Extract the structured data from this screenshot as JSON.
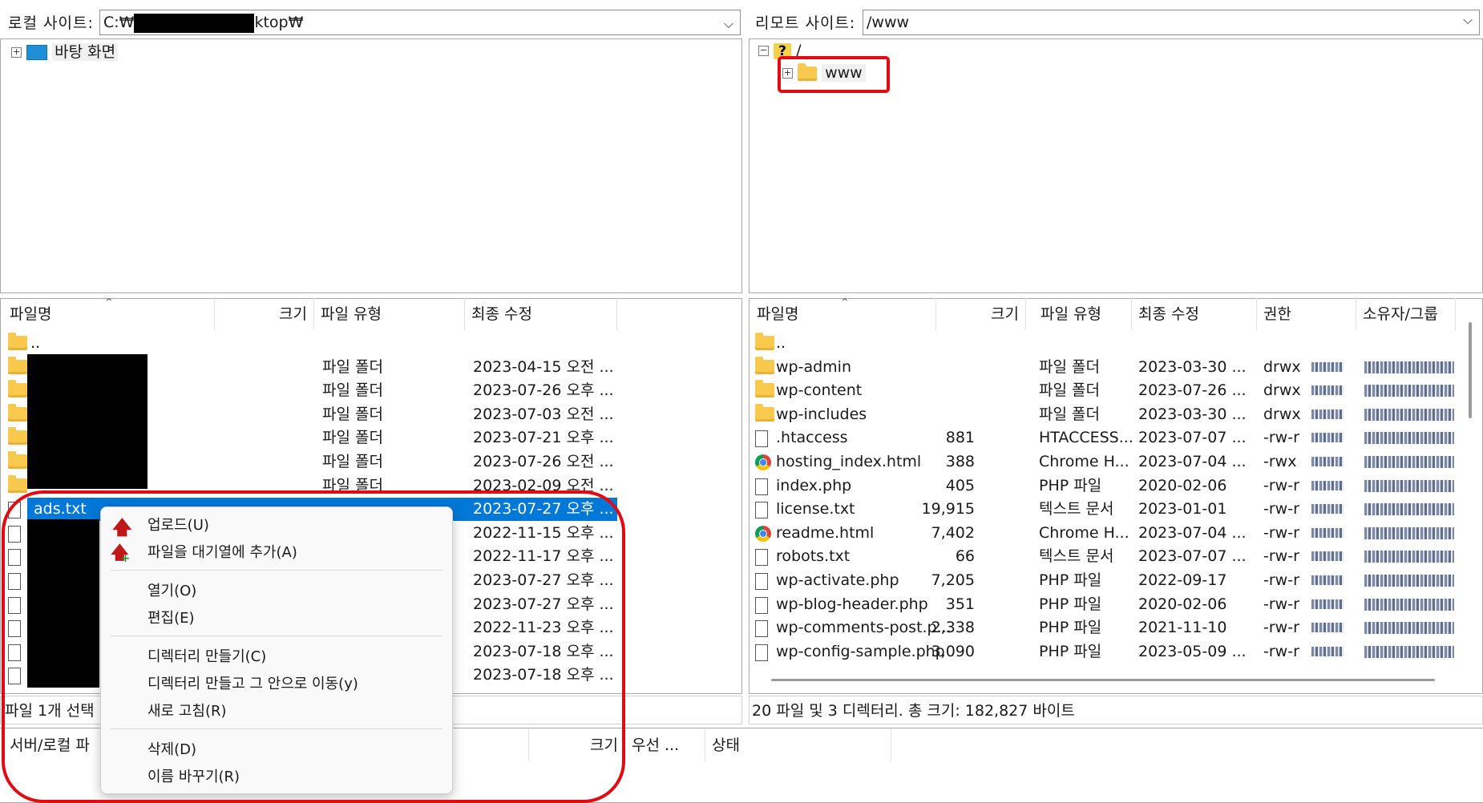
{
  "local": {
    "site_label": "로컬 사이트:",
    "path_prefix": "C:₩",
    "path_suffix": "ktop₩",
    "tree_item": "바탕 화면",
    "columns": [
      "파일명",
      "크기",
      "파일 유형",
      "최종 수정"
    ],
    "rows": [
      {
        "name": "..",
        "type": "",
        "date": ""
      },
      {
        "name": "",
        "type": "파일 폴더",
        "date": "2023-04-15 오전 ..."
      },
      {
        "name": "",
        "type": "파일 폴더",
        "date": "2023-07-26 오후 ..."
      },
      {
        "name": "",
        "type": "파일 폴더",
        "date": "2023-07-03 오전 ..."
      },
      {
        "name": "",
        "type": "파일 폴더",
        "date": "2023-07-21 오후 ..."
      },
      {
        "name": "",
        "type": "파일 폴더",
        "date": "2023-07-26 오전 ..."
      },
      {
        "name": "",
        "type": "파일 폴더",
        "date": "2023-02-09 오전 ..."
      },
      {
        "name": "ads.txt",
        "type": "",
        "date": "2023-07-27 오후 ..."
      },
      {
        "name": "",
        "type": "",
        "date": "2022-11-15 오후 ..."
      },
      {
        "name": "",
        "type": "",
        "date": "2022-11-17 오후 ..."
      },
      {
        "name": "",
        "type": "",
        "date": "2023-07-27 오후 ..."
      },
      {
        "name": "",
        "type": "",
        "date": "2023-07-27 오후 ..."
      },
      {
        "name": "",
        "type": "",
        "date": "2022-11-23 오후 ..."
      },
      {
        "name": "",
        "type": "",
        "date": "2023-07-18 오후 ..."
      },
      {
        "name": "",
        "type": "",
        "date": "2023-07-18 오후 ..."
      }
    ],
    "status": "파일 1개 선택"
  },
  "remote": {
    "site_label": "리모트 사이트:",
    "path": "/www",
    "tree_root": "/",
    "tree_item": "www",
    "columns": [
      "파일명",
      "크기",
      "파일 유형",
      "최종 수정",
      "권한",
      "소유자/그룹"
    ],
    "rows": [
      {
        "name": "..",
        "size": "",
        "type": "",
        "date": "",
        "perm": "",
        "icon": "folder"
      },
      {
        "name": "wp-admin",
        "size": "",
        "type": "파일 폴더",
        "date": "2023-03-30 ...",
        "perm": "drwx",
        "icon": "folder"
      },
      {
        "name": "wp-content",
        "size": "",
        "type": "파일 폴더",
        "date": "2023-07-26 ...",
        "perm": "drwx",
        "icon": "folder"
      },
      {
        "name": "wp-includes",
        "size": "",
        "type": "파일 폴더",
        "date": "2023-03-30 ...",
        "perm": "drwx",
        "icon": "folder"
      },
      {
        "name": ".htaccess",
        "size": "881",
        "type": "HTACCESS...",
        "date": "2023-07-07 ...",
        "perm": "-rw-r",
        "icon": "file"
      },
      {
        "name": "hosting_index.html",
        "size": "388",
        "type": "Chrome H...",
        "date": "2023-07-04 ...",
        "perm": "-rwx",
        "icon": "chrome"
      },
      {
        "name": "index.php",
        "size": "405",
        "type": "PHP 파일",
        "date": "2020-02-06",
        "perm": "-rw-r",
        "icon": "file"
      },
      {
        "name": "license.txt",
        "size": "19,915",
        "type": "텍스트 문서",
        "date": "2023-01-01",
        "perm": "-rw-r",
        "icon": "file"
      },
      {
        "name": "readme.html",
        "size": "7,402",
        "type": "Chrome H...",
        "date": "2023-07-04 ...",
        "perm": "-rw-r",
        "icon": "chrome"
      },
      {
        "name": "robots.txt",
        "size": "66",
        "type": "텍스트 문서",
        "date": "2023-07-07 ...",
        "perm": "-rw-r",
        "icon": "file"
      },
      {
        "name": "wp-activate.php",
        "size": "7,205",
        "type": "PHP 파일",
        "date": "2022-09-17",
        "perm": "-rw-r",
        "icon": "file"
      },
      {
        "name": "wp-blog-header.php",
        "size": "351",
        "type": "PHP 파일",
        "date": "2020-02-06",
        "perm": "-rw-r",
        "icon": "file"
      },
      {
        "name": "wp-comments-post.p...",
        "size": "2,338",
        "type": "PHP 파일",
        "date": "2021-11-10",
        "perm": "-rw-r",
        "icon": "file"
      },
      {
        "name": "wp-config-sample.php",
        "size": "3,090",
        "type": "PHP 파일",
        "date": "2023-05-09 ...",
        "perm": "-rw-r",
        "icon": "file"
      }
    ],
    "status": "20 파일 및 3 디렉터리. 총 크기: 182,827 바이트"
  },
  "queue": {
    "columns": [
      "서버/로컬 파",
      "크기",
      "우선 ...",
      "상태"
    ]
  },
  "context_menu": {
    "upload": "업로드(U)",
    "add_queue": "파일을 대기열에 추가(A)",
    "open": "열기(O)",
    "edit": "편집(E)",
    "mkdir": "디렉터리 만들기(C)",
    "mkdir_enter": "디렉터리 만들고 그 안으로 이동(y)",
    "refresh": "새로 고침(R)",
    "delete": "삭제(D)",
    "rename": "이름 바꾸기(R)"
  },
  "colors": {
    "highlight": "#e30b13",
    "selection": "#0078d7"
  }
}
